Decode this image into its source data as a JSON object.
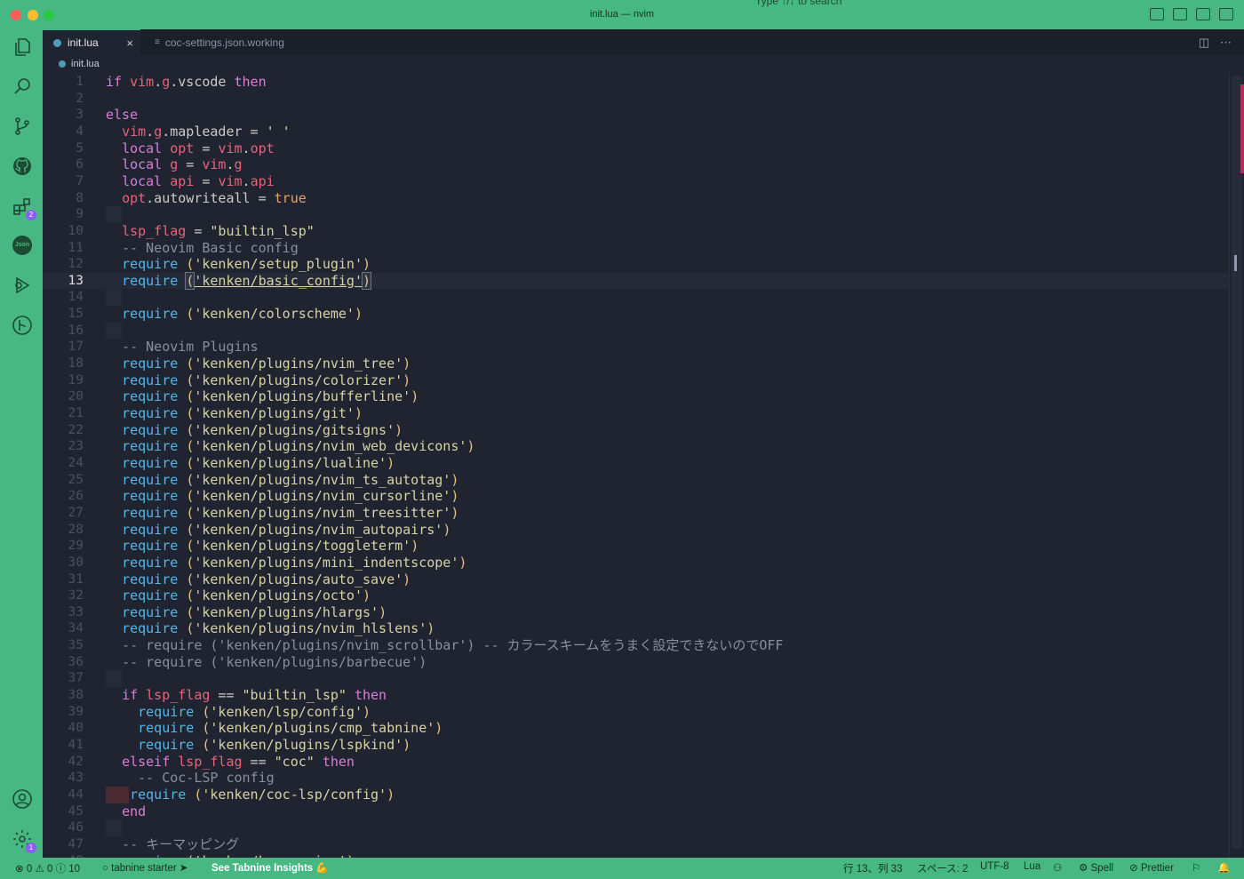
{
  "window": {
    "title": "init.lua — nvim",
    "search_hint": "Type ↑/↓ to search"
  },
  "colors": {
    "accent": "#47b883",
    "editor_bg": "#1f2430"
  },
  "activity": {
    "icons": [
      "files-icon",
      "search-icon",
      "source-control-icon",
      "github-icon",
      "extensions-icon",
      "json-icon",
      "run-debug-icon",
      "git-graph-icon",
      "account-icon",
      "settings-gear-icon"
    ],
    "extensions_badge": "2",
    "json_label": "Json",
    "settings_badge": "1"
  },
  "tabs": [
    {
      "label": "init.lua",
      "active": true,
      "close": "×"
    },
    {
      "label": "coc-settings.json.working",
      "active": false
    }
  ],
  "breadcrumb": {
    "file": "init.lua"
  },
  "editor": {
    "current_line": 13,
    "lines": [
      "if vim.g.vscode then",
      "",
      "else",
      "  vim.g.mapleader = ' '",
      "  local opt = vim.opt",
      "  local g = vim.g",
      "  local api = vim.api",
      "  opt.autowriteall = true",
      "",
      "  lsp_flag = \"builtin_lsp\"",
      "  -- Neovim Basic config",
      "  require ('kenken/setup_plugin')",
      "  require ('kenken/basic_config')",
      "",
      "  require ('kenken/colorscheme')",
      "",
      "  -- Neovim Plugins",
      "  require ('kenken/plugins/nvim_tree')",
      "  require ('kenken/plugins/colorizer')",
      "  require ('kenken/plugins/bufferline')",
      "  require ('kenken/plugins/git')",
      "  require ('kenken/plugins/gitsigns')",
      "  require ('kenken/plugins/nvim_web_devicons')",
      "  require ('kenken/plugins/lualine')",
      "  require ('kenken/plugins/nvim_ts_autotag')",
      "  require ('kenken/plugins/nvim_cursorline')",
      "  require ('kenken/plugins/nvim_treesitter')",
      "  require ('kenken/plugins/nvim_autopairs')",
      "  require ('kenken/plugins/toggleterm')",
      "  require ('kenken/plugins/mini_indentscope')",
      "  require ('kenken/plugins/auto_save')",
      "  require ('kenken/plugins/octo')",
      "  require ('kenken/plugins/hlargs')",
      "  require ('kenken/plugins/nvim_hlslens')",
      "  -- require ('kenken/plugins/nvim_scrollbar') -- カラースキームをうまく設定できないのでOFF",
      "  -- require ('kenken/plugins/barbecue')",
      "",
      "  if lsp_flag == \"builtin_lsp\" then",
      "    require ('kenken/lsp/config')",
      "    require ('kenken/plugins/cmp_tabnine')",
      "    require ('kenken/plugins/lspkind')",
      "  elseif lsp_flag == \"coc\" then",
      "    -- Coc-LSP config",
      "   require ('kenken/coc-lsp/config')",
      "  end",
      "",
      "  -- キーマッピング",
      "  require ('kenken/keymapping')"
    ]
  },
  "statusbar": {
    "errors": "0",
    "warnings": "0",
    "info": "10",
    "tabnine": "tabnine starter",
    "tabnine_insights": "See Tabnine Insights",
    "position": "行 13、列 33",
    "spaces": "スペース: 2",
    "encoding": "UTF-8",
    "language": "Lua",
    "spell": "Spell",
    "prettier": "Prettier"
  }
}
